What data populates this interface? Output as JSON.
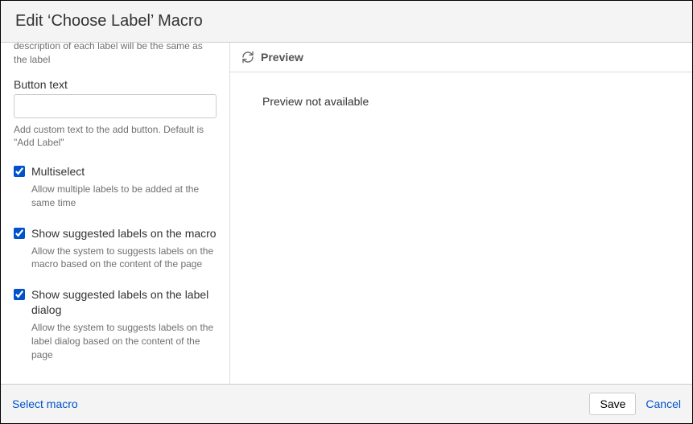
{
  "header": {
    "title": "Edit ‘Choose Label’ Macro"
  },
  "form": {
    "truncated_hint": "description of each label will be the same as the label",
    "button_text": {
      "label": "Button text",
      "value": "",
      "hint": "Add custom text to the add button. Default is \"Add Label\""
    },
    "multiselect": {
      "label": "Multiselect",
      "hint": "Allow multiple labels to be added at the same time"
    },
    "suggested_macro": {
      "label": "Show suggested labels on the macro",
      "hint": "Allow the system to suggests labels on the macro based on the content of the page"
    },
    "suggested_dialog": {
      "label": "Show suggested labels on the label dialog",
      "hint": "Allow the system to suggests labels on the label dialog based on the content of the page"
    }
  },
  "preview": {
    "title": "Preview",
    "body": "Preview not available"
  },
  "footer": {
    "select_macro": "Select macro",
    "save": "Save",
    "cancel": "Cancel"
  }
}
